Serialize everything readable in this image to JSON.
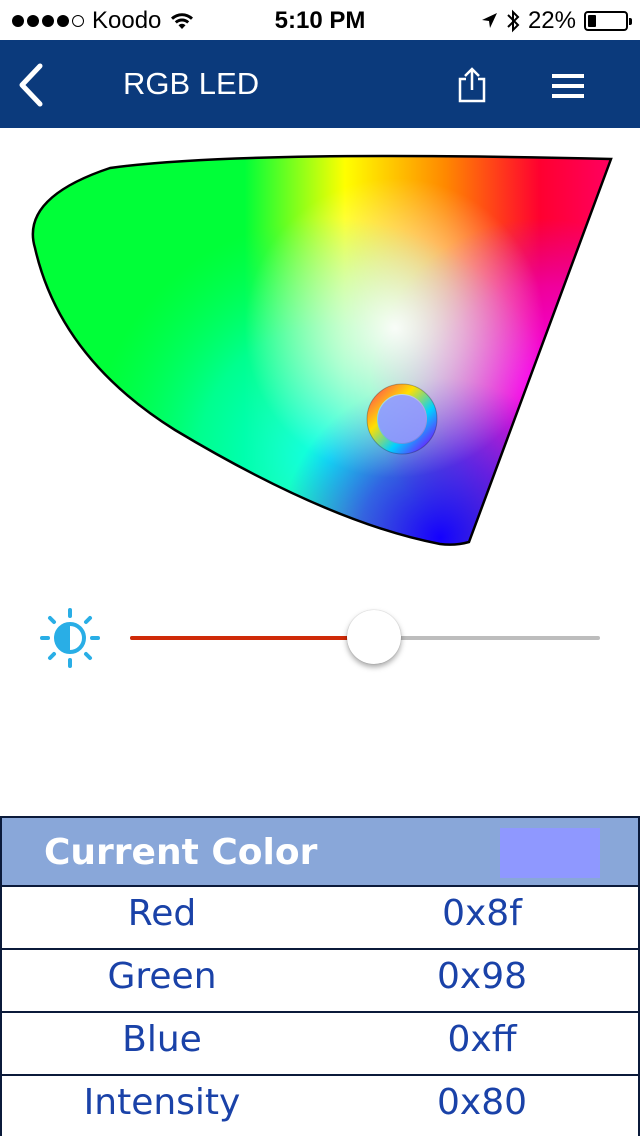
{
  "status_bar": {
    "carrier": "Koodo",
    "time": "5:10 PM",
    "battery_percent": "22%",
    "battery_level": 0.22,
    "signal_bars_filled": 4,
    "signal_bars_total": 5,
    "icons": [
      "wifi-icon",
      "location-arrow-icon",
      "bluetooth-icon",
      "battery-icon"
    ]
  },
  "nav": {
    "title": "RGB LED",
    "background": "#0b3a7c",
    "icons": [
      "back-chevron-icon",
      "share-icon",
      "hamburger-menu-icon"
    ]
  },
  "color_picker": {
    "icon": "color-selector-ring-icon"
  },
  "brightness": {
    "icon": "brightness-icon",
    "icon_color": "#29aee6",
    "level": 0.52,
    "fill_color": "#cf2a08"
  },
  "color_table": {
    "header": "Current Color",
    "header_background": "#89a7d9",
    "swatch_color": "#8f98ff",
    "rows": [
      {
        "label": "Red",
        "value": "0x8f"
      },
      {
        "label": "Green",
        "value": "0x98"
      },
      {
        "label": "Blue",
        "value": "0xff"
      },
      {
        "label": "Intensity",
        "value": "0x80"
      }
    ],
    "text_color": "#1a42a8"
  }
}
